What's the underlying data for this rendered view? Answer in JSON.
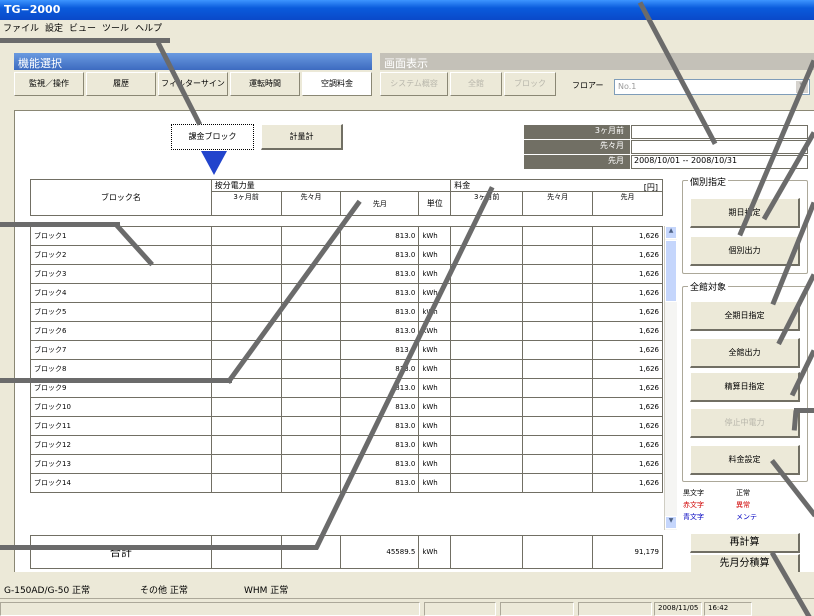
{
  "window": {
    "title": "TG−2000"
  },
  "menu": [
    "ファイル",
    "設定",
    "ビュー",
    "ツール",
    "ヘルプ"
  ],
  "func_header": "機能選択",
  "screen_header": "画面表示",
  "func_tabs": [
    "監視／操作",
    "履歴",
    "フィルターサイン",
    "運転時間",
    "空調料金"
  ],
  "screen_tabs": [
    "システム概容",
    "全館",
    "ブロック"
  ],
  "floor": {
    "label": "フロアー",
    "value": "No.1"
  },
  "view_buttons": {
    "billing_block": "課金ブロック",
    "meter": "計量計"
  },
  "periods": {
    "m3": "3ヶ月前",
    "m2": "先々月",
    "m1": "先月",
    "m3_val": "",
    "m2_val": "",
    "m1_val": "2008/10/01 -- 2008/10/31"
  },
  "table": {
    "block_header": "ブロック名",
    "power_header": "按分電力量",
    "fee_header": "料金",
    "fee_unit": "[円]",
    "sub": {
      "m3": "3ヶ月前",
      "m2": "先々月",
      "m1": "先月",
      "unit": "単位"
    },
    "rows": [
      {
        "name": "ブロック1",
        "kwh": "813.0",
        "unit": "kWh",
        "fee": "1,626"
      },
      {
        "name": "ブロック2",
        "kwh": "813.0",
        "unit": "kWh",
        "fee": "1,626"
      },
      {
        "name": "ブロック3",
        "kwh": "813.0",
        "unit": "kWh",
        "fee": "1,626"
      },
      {
        "name": "ブロック4",
        "kwh": "813.0",
        "unit": "kWh",
        "fee": "1,626"
      },
      {
        "name": "ブロック5",
        "kwh": "813.0",
        "unit": "kWh",
        "fee": "1,626"
      },
      {
        "name": "ブロック6",
        "kwh": "813.0",
        "unit": "kWh",
        "fee": "1,626"
      },
      {
        "name": "ブロック7",
        "kwh": "813.0",
        "unit": "kWh",
        "fee": "1,626"
      },
      {
        "name": "ブロック8",
        "kwh": "813.0",
        "unit": "kWh",
        "fee": "1,626"
      },
      {
        "name": "ブロック9",
        "kwh": "813.0",
        "unit": "kWh",
        "fee": "1,626"
      },
      {
        "name": "ブロック10",
        "kwh": "813.0",
        "unit": "kWh",
        "fee": "1,626"
      },
      {
        "name": "ブロック11",
        "kwh": "813.0",
        "unit": "kWh",
        "fee": "1,626"
      },
      {
        "name": "ブロック12",
        "kwh": "813.0",
        "unit": "kWh",
        "fee": "1,626"
      },
      {
        "name": "ブロック13",
        "kwh": "813.0",
        "unit": "kWh",
        "fee": "1,626"
      },
      {
        "name": "ブロック14",
        "kwh": "813.0",
        "unit": "kWh",
        "fee": "1,626"
      }
    ],
    "total": {
      "label": "合計",
      "kwh": "45589.5",
      "unit": "kWh",
      "fee": "91,179"
    }
  },
  "individual": {
    "title": "個別指定",
    "period_btn": "期日指定",
    "output_btn": "個別出力"
  },
  "all_floors": {
    "title": "全館対象",
    "period_btn": "全期日指定",
    "output_btn": "全館出力",
    "calc_btn": "精算日指定",
    "stopped_btn": "停止中電力"
  },
  "fee_setting_btn": "料金設定",
  "legend": [
    {
      "text": "黒文字",
      "status": "正常",
      "text_color": "#000000",
      "status_color": "#000000"
    },
    {
      "text": "赤文字",
      "status": "異常",
      "text_color": "#d00000",
      "status_color": "#d00000"
    },
    {
      "text": "青文字",
      "status": "メンテ",
      "text_color": "#0000c0",
      "status_color": "#0000c0"
    }
  ],
  "recalc_btn": "再計算",
  "lastmonth_btn": "先月分積算",
  "status": {
    "s1": "G-150AD/G-50 正常",
    "s2": "その他 正常",
    "s3": "WHM 正常",
    "date": "2008/11/05",
    "time": "16:42"
  }
}
